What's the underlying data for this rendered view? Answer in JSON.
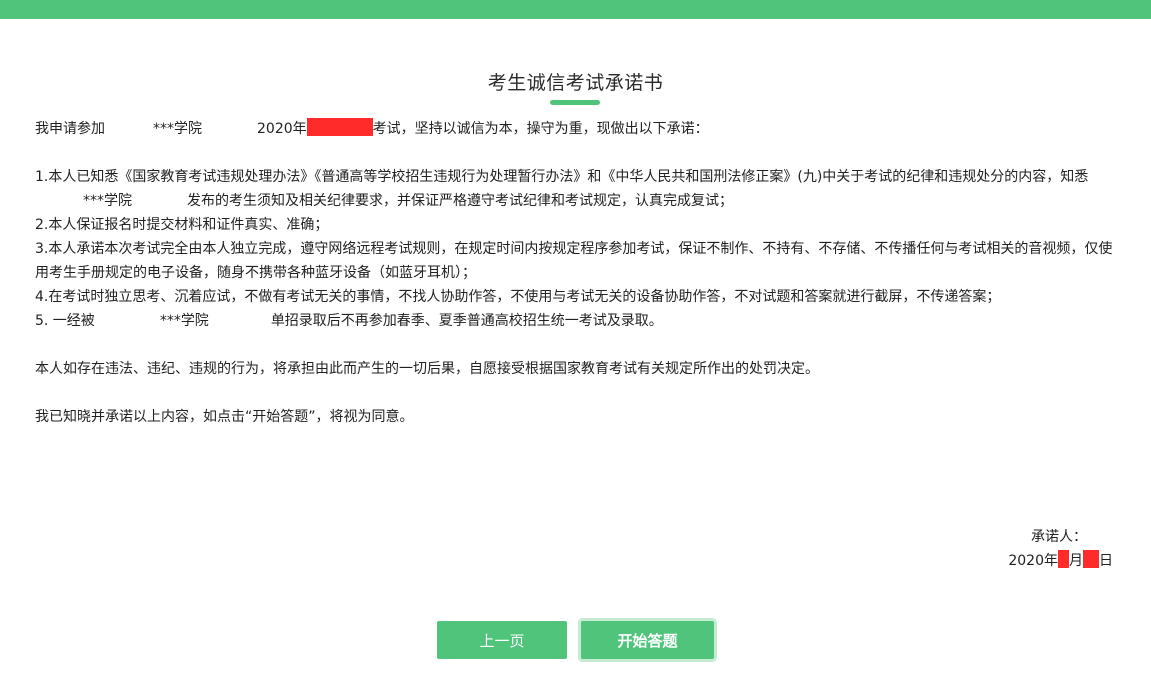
{
  "page": {
    "title": "考生诚信考试承诺书"
  },
  "colors": {
    "accent": "#4fc47a",
    "redaction": "#ff2b2b"
  },
  "letter": {
    "intro": {
      "prefix": "我申请参加",
      "school": "***学院",
      "year": "2020年",
      "suffix": "考试，坚持以诚信为本，操守为重，现做出以下承诺："
    },
    "item1_part1": "1.本人已知悉《国家教育考试违规处理办法》《普通高等学校招生违规行为处理暂行办法》和《中华人民共和国刑法修正案》(九)中关于考试的纪律和违规处分的内容，知悉",
    "item1_school": "***学院",
    "item1_part2": "发布的考生须知及相关纪律要求，并保证严格遵守考试纪律和考试规定，认真完成复试；",
    "item2": "2.本人保证报名时提交材料和证件真实、准确；",
    "item3": "3.本人承诺本次考试完全由本人独立完成，遵守网络远程考试规则，在规定时间内按规定程序参加考试，保证不制作、不持有、不存储、不传播任何与考试相关的音视频，仅使用考生手册规定的电子设备，随身不携带各种蓝牙设备（如蓝牙耳机）；",
    "item4": "4.在考试时独立思考、沉着应试，不做有考试无关的事情，不找人协助作答，不使用与考试无关的设备协助作答，不对试题和答案就进行截屏，不传递答案；",
    "item5_prefix": "5. 一经被",
    "item5_school": "***学院",
    "item5_suffix": "单招录取后不再参加春季、夏季普通高校招生统一考试及录取。",
    "consequence": "本人如存在违法、违纪、违规的行为，将承担由此而产生的一切后果，自愿接受根据国家教育考试有关规定所作出的处罚决定。",
    "acknowledge": "我已知晓并承诺以上内容，如点击“开始答题”，将视为同意。"
  },
  "signature": {
    "label": "承诺人：",
    "year": "2020年",
    "month": "月",
    "day": "日"
  },
  "buttons": {
    "prev": "上一页",
    "start": "开始答题"
  }
}
